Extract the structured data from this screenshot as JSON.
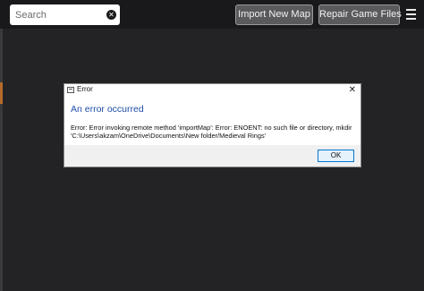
{
  "search": {
    "placeholder": "Search",
    "value": ""
  },
  "toolbar": {
    "import_label": "Import New Map",
    "repair_label": "Repair Game Files"
  },
  "icons": {
    "clear": "clear-icon",
    "menu": "hamburger-menu-icon",
    "dialog": "window-icon",
    "close": "close-icon"
  },
  "dialog": {
    "title": "Error",
    "close_glyph": "✕",
    "heading": "An error occurred",
    "message_line1": "Error: Error invoking remote method 'importMap': Error: ENOENT: no such file or directory, mkdir",
    "message_line2": "'C:\\Users\\akzam\\OneDrive\\Documents\\New folder/Medieval Rings'",
    "ok_label": "OK"
  },
  "colors": {
    "background": "#232325",
    "heading_blue": "#1f4fa8",
    "ok_border": "#0078d7"
  }
}
